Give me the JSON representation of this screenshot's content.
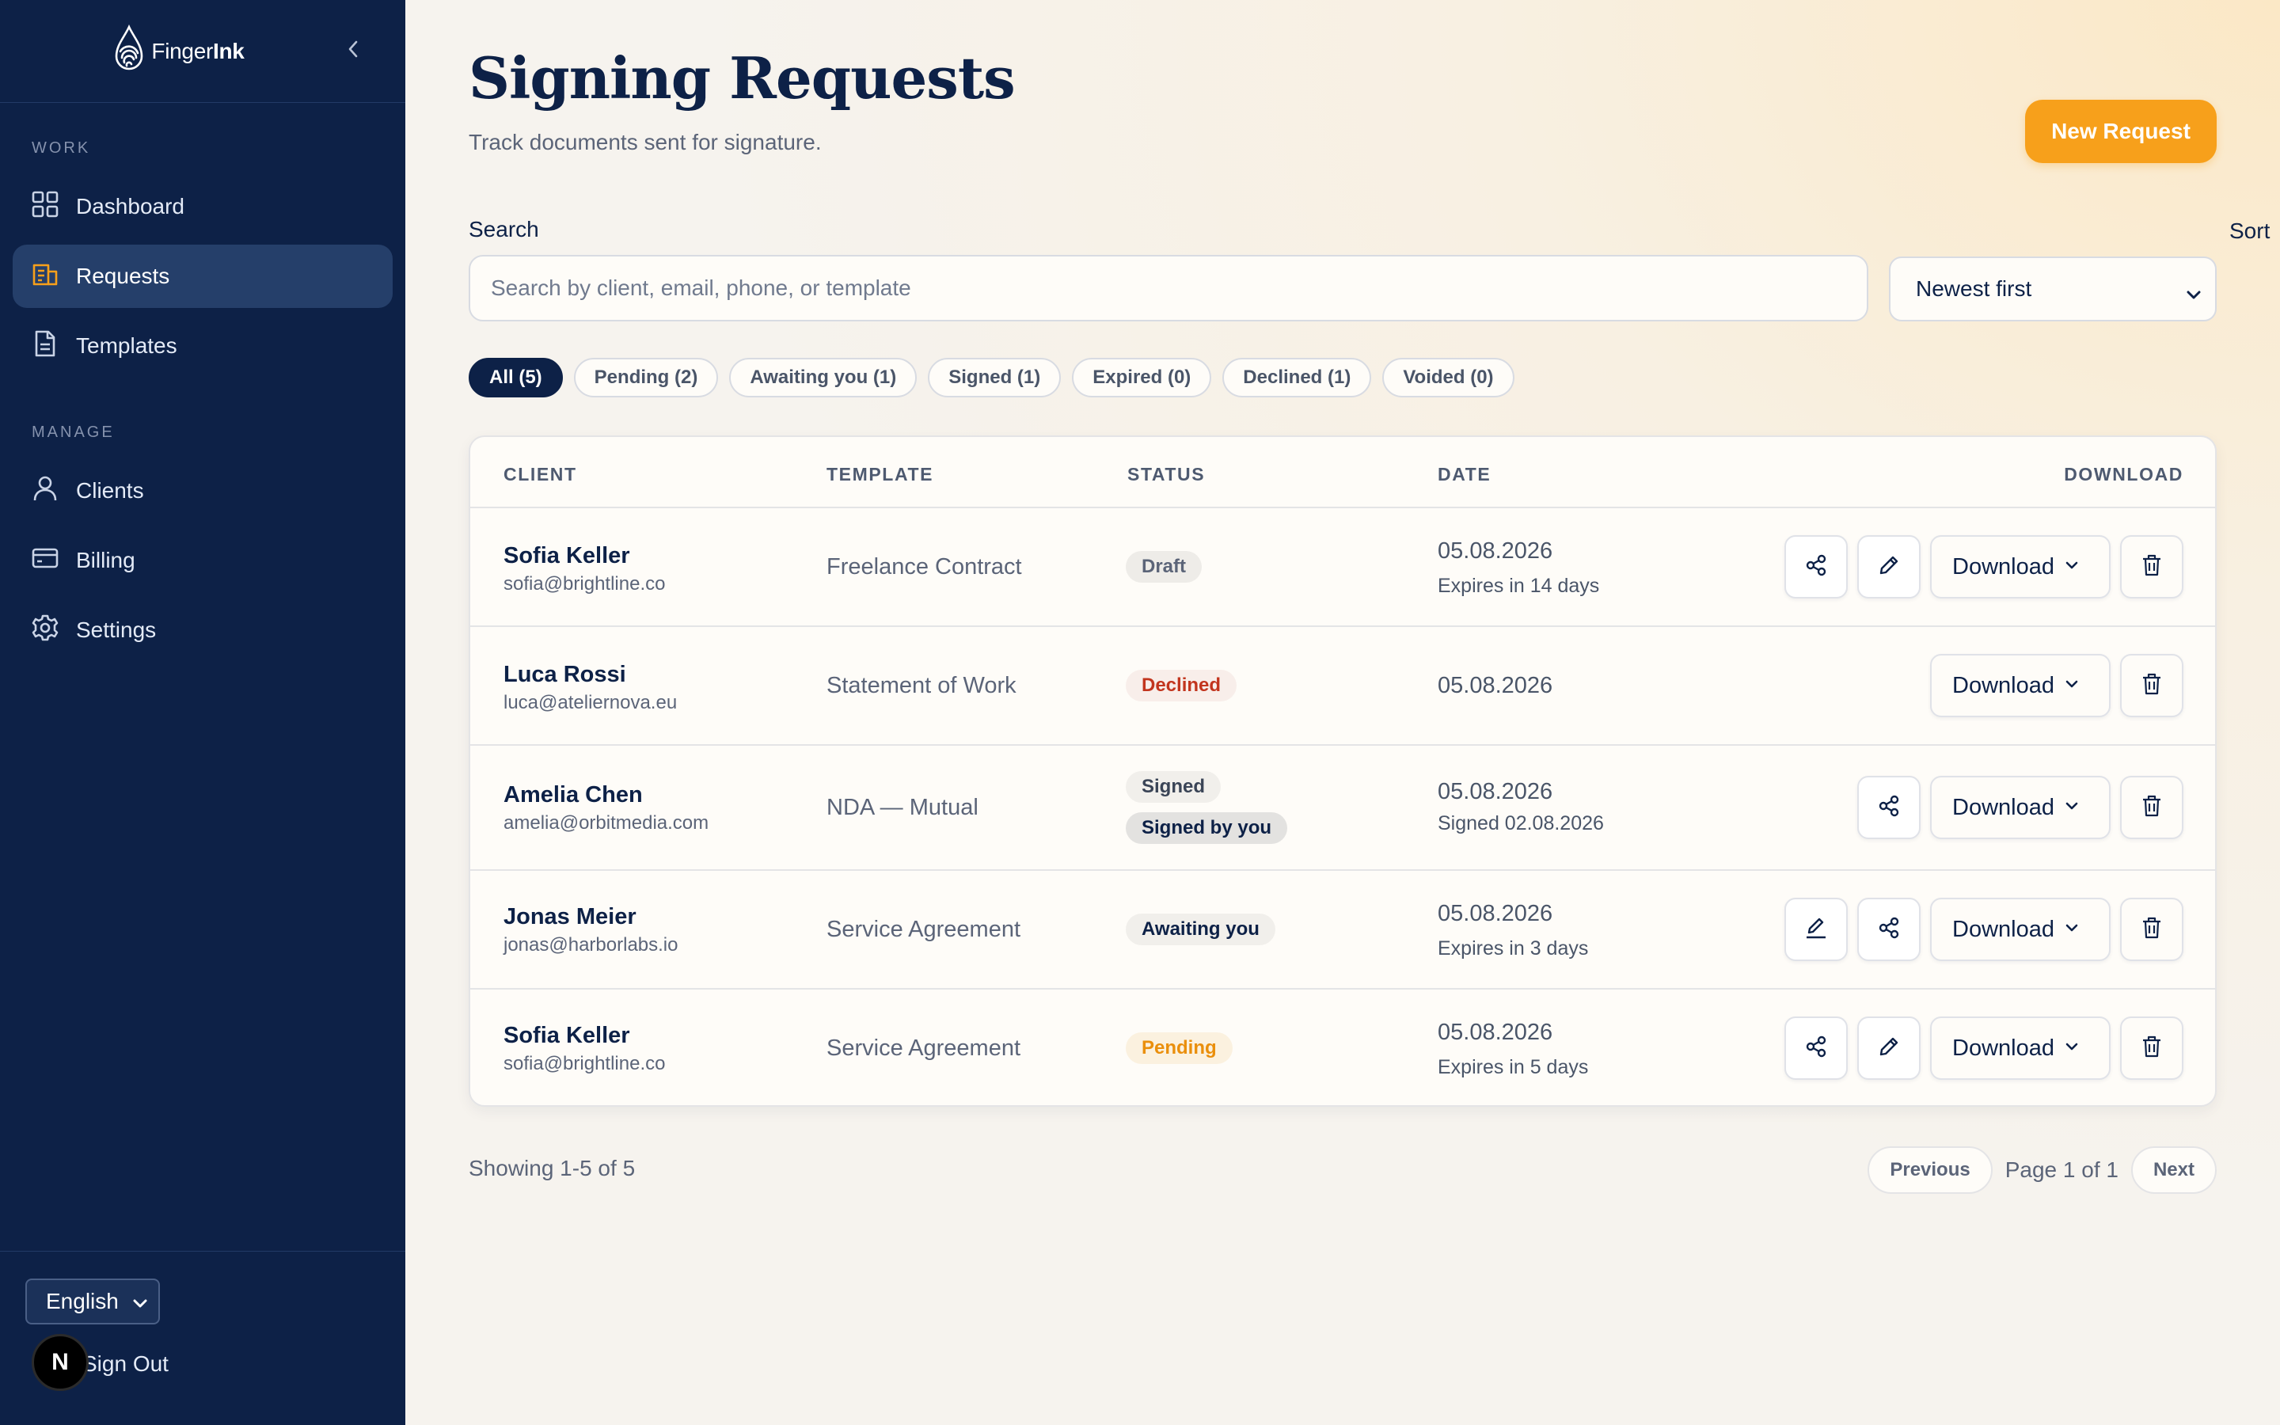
{
  "brand": {
    "name_light": "Finger",
    "name_bold": "Ink"
  },
  "sidebar": {
    "sections": [
      {
        "title": "WORK",
        "items": [
          {
            "label": "Dashboard",
            "icon": "grid-icon"
          },
          {
            "label": "Requests",
            "icon": "requests-icon",
            "active": true
          },
          {
            "label": "Templates",
            "icon": "document-icon"
          }
        ]
      },
      {
        "title": "MANAGE",
        "items": [
          {
            "label": "Clients",
            "icon": "user-icon"
          },
          {
            "label": "Billing",
            "icon": "card-icon"
          },
          {
            "label": "Settings",
            "icon": "gear-icon"
          }
        ]
      }
    ],
    "language": "English",
    "signout": "Sign Out",
    "avatar_letter": "N"
  },
  "header": {
    "title": "Signing Requests",
    "subtitle": "Track documents sent for signature.",
    "new_request": "New Request"
  },
  "search": {
    "label": "Search",
    "placeholder": "Search by client, email, phone, or template",
    "value": ""
  },
  "sort": {
    "label": "Sort",
    "value": "Newest first"
  },
  "filters": [
    {
      "label": "All (5)",
      "active": true
    },
    {
      "label": "Pending (2)"
    },
    {
      "label": "Awaiting you (1)"
    },
    {
      "label": "Signed (1)"
    },
    {
      "label": "Expired (0)"
    },
    {
      "label": "Declined (1)"
    },
    {
      "label": "Voided (0)"
    }
  ],
  "table": {
    "columns": {
      "client": "CLIENT",
      "template": "TEMPLATE",
      "status": "STATUS",
      "date": "DATE",
      "download": "DOWNLOAD"
    },
    "download_label": "Download",
    "rows": [
      {
        "name": "Sofia Keller",
        "email": "sofia@brightline.co",
        "template": "Freelance Contract",
        "status": "Draft",
        "date": "05.08.2026",
        "date_sub": "Expires in 14 days"
      },
      {
        "name": "Luca Rossi",
        "email": "luca@ateliernova.eu",
        "template": "Statement of Work",
        "status": "Declined",
        "date": "05.08.2026",
        "date_sub": ""
      },
      {
        "name": "Amelia Chen",
        "email": "amelia@orbitmedia.com",
        "template": "NDA — Mutual",
        "status": "Signed",
        "status_extra": "Signed by you",
        "date": "05.08.2026",
        "date_sub": "Signed 02.08.2026"
      },
      {
        "name": "Jonas Meier",
        "email": "jonas@harborlabs.io",
        "template": "Service Agreement",
        "status": "Awaiting you",
        "date": "05.08.2026",
        "date_sub": "Expires in 3 days"
      },
      {
        "name": "Sofia Keller",
        "email": "sofia@brightline.co",
        "template": "Service Agreement",
        "status": "Pending",
        "date": "05.08.2026",
        "date_sub": "Expires in 5 days"
      }
    ]
  },
  "pagination": {
    "showing": "Showing 1-5 of 5",
    "previous": "Previous",
    "page_info": "Page 1 of 1",
    "next": "Next"
  },
  "colors": {
    "sidebar_bg": "#0d2147",
    "accent": "#f7a01b",
    "declined": "#c2351e",
    "pending": "#ea8f0c"
  }
}
